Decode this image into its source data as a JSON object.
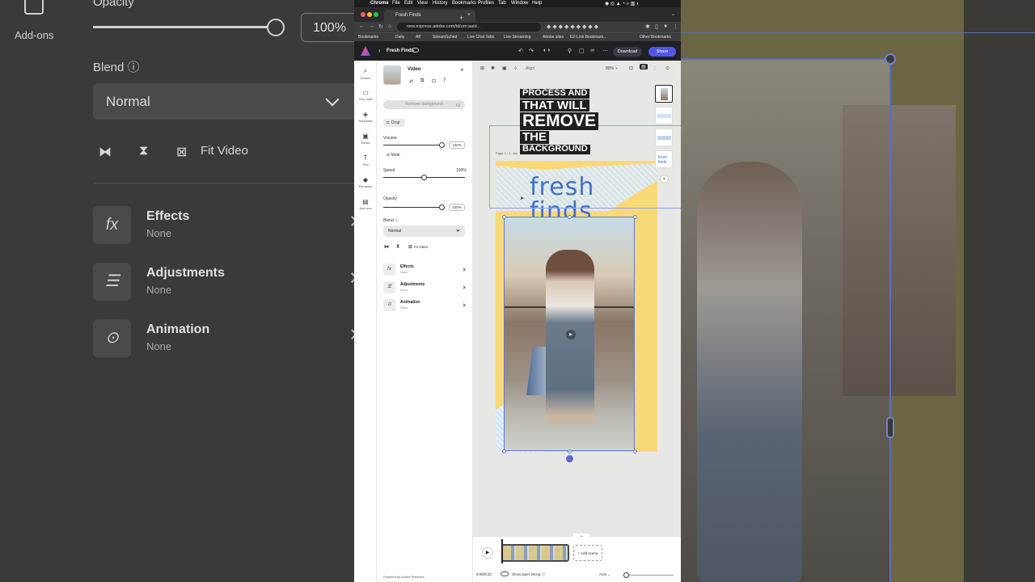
{
  "left_zoom": {
    "addons_label": "Add-ons",
    "opacity_label": "Opacity",
    "opacity_value": "100%",
    "blend_label": "Blend",
    "blend_value": "Normal",
    "fit_video_label": "Fit Video",
    "rows": [
      {
        "title": "Effects",
        "sub": "None",
        "glyph": "fx"
      },
      {
        "title": "Adjustments",
        "sub": "None",
        "glyph": "☰"
      },
      {
        "title": "Animation",
        "sub": "None",
        "glyph": "⊙"
      }
    ]
  },
  "mac_menu": [
    "Chrome",
    "File",
    "Edit",
    "View",
    "History",
    "Bookmarks",
    "Profiles",
    "Tab",
    "Window",
    "Help"
  ],
  "browser": {
    "tab_title": "Fresh Finds",
    "url": "new.express.adobe.com/id/urn:aaid...",
    "bookmarks": [
      "Bookmarks",
      "Daily",
      "Aff",
      "StreamSched",
      "Live Chat Tabs",
      "Live Streaming",
      "Adobe sites",
      "EZ-Link Bookmark...",
      "Other Bookmarks"
    ]
  },
  "app_header": {
    "doc_title": "Fresh Finds",
    "download_label": "Download",
    "share_label": "Share"
  },
  "rail": [
    {
      "label": "Search",
      "glyph": "⌕"
    },
    {
      "label": "Your stuff",
      "glyph": "▭"
    },
    {
      "label": "Templates",
      "glyph": "◈"
    },
    {
      "label": "Media",
      "glyph": "▣"
    },
    {
      "label": "Text",
      "glyph": "T"
    },
    {
      "label": "Elements",
      "glyph": "◆"
    },
    {
      "label": "Add-ons",
      "glyph": "▤"
    }
  ],
  "panel": {
    "title": "Video",
    "remove_bg_label": "Remove background",
    "crop_label": "Crop",
    "volume_label": "Volume",
    "volume_value": "100%",
    "volume_level": 1.0,
    "mute_label": "Mute",
    "speed_label": "Speed",
    "speed_value": "100%",
    "speed_level": 0.5,
    "opacity_label": "Opacity",
    "opacity_value": "100%",
    "opacity_level": 1.0,
    "blend_label": "Blend",
    "blend_value": "Normal",
    "fit_video_label": "Fit Video",
    "rows": [
      {
        "title": "Effects",
        "sub": "None",
        "glyph": "fx"
      },
      {
        "title": "Adjustments",
        "sub": "None",
        "glyph": "☰"
      },
      {
        "title": "Animation",
        "sub": "None",
        "glyph": "⊙"
      }
    ],
    "powered_by": "Powered by Adobe Premiere"
  },
  "canvas": {
    "align_label": "Align",
    "zoom_value": "80%",
    "page_label": "Page 1 / 1 - Ad",
    "headline": [
      "PROCESS AND",
      "THAT WILL",
      "REMOVE",
      "THE",
      "BACKGROUND"
    ],
    "brand_text": "fresh finds",
    "colors": {
      "page": "#f9d977",
      "brand": "#3f72c8",
      "accent": "#5258e4"
    }
  },
  "timeline": {
    "add_scene_label": "+ Add scene",
    "time": "0:00/0:23",
    "layer_timing_label": "Show layer timing",
    "auto_label": "Auto"
  }
}
